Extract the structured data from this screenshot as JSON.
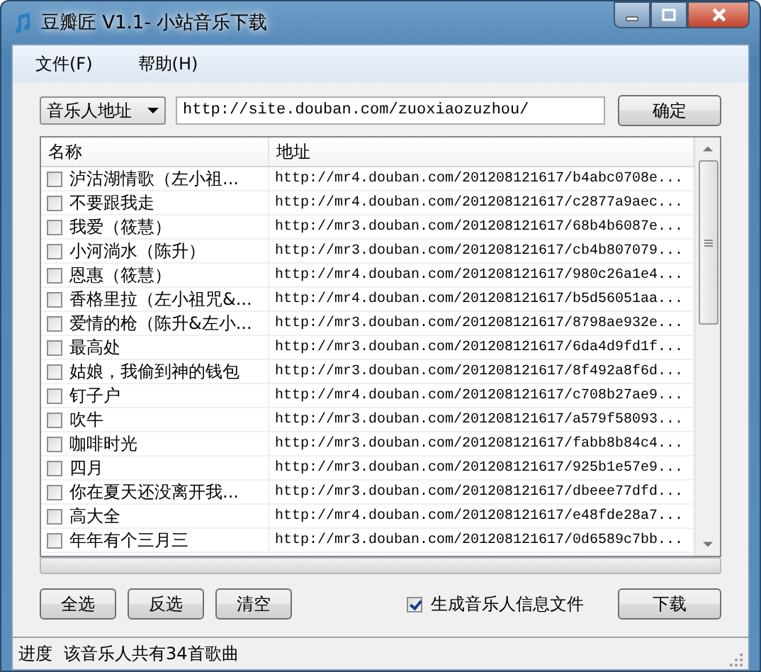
{
  "window": {
    "title": "豆瓣匠 V1.1- 小站音乐下载"
  },
  "menu": [
    "文件(F)",
    "帮助(H)"
  ],
  "source": {
    "dropdown": "音乐人地址",
    "url": "http://site.douban.com/zuoxiaozuzhou/",
    "confirm": "确定"
  },
  "table": {
    "columns": [
      "名称",
      "地址"
    ],
    "rows": [
      {
        "name": "泸沽湖情歌（左小祖...",
        "url": "http://mr4.douban.com/201208121617/b4abc0708e...",
        "checked": false
      },
      {
        "name": "不要跟我走",
        "url": "http://mr4.douban.com/201208121617/c2877a9aec...",
        "checked": false
      },
      {
        "name": "我爱（筱慧）",
        "url": "http://mr3.douban.com/201208121617/68b4b6087e...",
        "checked": false
      },
      {
        "name": "小河淌水（陈升）",
        "url": "http://mr3.douban.com/201208121617/cb4b807079...",
        "checked": false
      },
      {
        "name": "恩惠（筱慧）",
        "url": "http://mr4.douban.com/201208121617/980c26a1e4...",
        "checked": false
      },
      {
        "name": "香格里拉（左小祖咒&...",
        "url": "http://mr4.douban.com/201208121617/b5d56051aa...",
        "checked": false
      },
      {
        "name": "爱情的枪（陈升&左小...",
        "url": "http://mr3.douban.com/201208121617/8798ae932e...",
        "checked": false
      },
      {
        "name": "最高处",
        "url": "http://mr3.douban.com/201208121617/6da4d9fd1f...",
        "checked": false
      },
      {
        "name": "姑娘，我偷到神的钱包",
        "url": "http://mr3.douban.com/201208121617/8f492a8f6d...",
        "checked": false
      },
      {
        "name": "钉子户",
        "url": "http://mr4.douban.com/201208121617/c708b27ae9...",
        "checked": false
      },
      {
        "name": "吹牛",
        "url": "http://mr3.douban.com/201208121617/a579f58093...",
        "checked": false
      },
      {
        "name": "咖啡时光",
        "url": "http://mr3.douban.com/201208121617/fabb8b84c4...",
        "checked": false
      },
      {
        "name": "四月",
        "url": "http://mr3.douban.com/201208121617/925b1e57e9...",
        "checked": false
      },
      {
        "name": "你在夏天还没离开我...",
        "url": "http://mr3.douban.com/201208121617/dbeee77dfd...",
        "checked": false
      },
      {
        "name": "高大全",
        "url": "http://mr4.douban.com/201208121617/e48fde28a7...",
        "checked": false
      },
      {
        "name": "年年有个三月三",
        "url": "http://mr3.douban.com/201208121617/0d6589c7bb...",
        "checked": false
      }
    ]
  },
  "actions": [
    "全选",
    "反选",
    "清空"
  ],
  "option": {
    "label": "生成音乐人信息文件",
    "checked": true
  },
  "download": "下载",
  "status_bar": {
    "label": "进度",
    "message": "该音乐人共有34首歌曲"
  }
}
